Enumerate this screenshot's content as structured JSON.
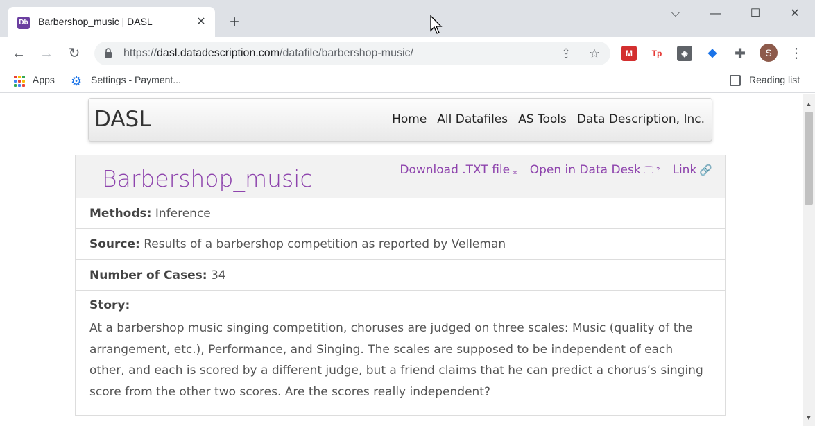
{
  "browser": {
    "tab_title": "Barbershop_music | DASL",
    "tab_favicon_text": "Db",
    "url_scheme": "https://",
    "url_host": "dasl.datadescription.com",
    "url_path": "/datafile/barbershop-music/",
    "avatar_letter": "S",
    "extensions": [
      {
        "name": "mendeley-extension",
        "text": "",
        "color": "#d32f2f"
      },
      {
        "name": "tp-extension",
        "text": "Tp",
        "color": "#e53935"
      },
      {
        "name": "shield-extension",
        "text": "",
        "color": "#5f6368"
      },
      {
        "name": "blue-extension",
        "text": "",
        "color": "#1a73e8"
      }
    ]
  },
  "bookmarks": {
    "apps_label": "Apps",
    "settings_label": "Settings - Payment...",
    "reading_list_label": "Reading list"
  },
  "site": {
    "brand": "DASL",
    "nav": [
      "Home",
      "All Datafiles",
      "AS Tools",
      "Data Description, Inc."
    ],
    "accent_color": "#8e44ad"
  },
  "dataset": {
    "title": "Barbershop_music",
    "download_label": "Download .TXT file",
    "open_label": "Open in Data Desk",
    "open_sup": "?",
    "link_label": "Link",
    "methods_label": "Methods:",
    "methods_value": "Inference",
    "source_label": "Source:",
    "source_value": "Results of a barbershop competition as reported by Velleman",
    "cases_label": "Number of Cases:",
    "cases_value": "34",
    "story_label": "Story:",
    "story_text": "At a barbershop music singing competition, choruses are judged on three scales: Music (quality of the arrangement, etc.), Performance, and Singing. The scales are supposed to be independent of each other, and each is scored by a different judge, but a friend claims that he can predict a chorus’s singing score from the other two scores. Are the scores really independent?"
  }
}
